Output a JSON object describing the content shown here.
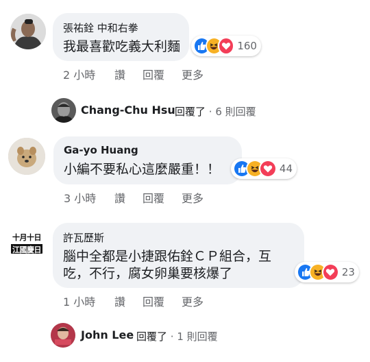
{
  "comments": [
    {
      "author": "張祐銓 中和右拳",
      "text": "我最喜歡吃義大利麵",
      "reactions": {
        "count": "160",
        "icons": [
          "like-icon",
          "haha-icon",
          "love-icon"
        ]
      },
      "actions": {
        "time": "2 小時",
        "like": "讚",
        "reply": "回覆",
        "more": "更多"
      }
    },
    {
      "author": "Ga-yo Huang",
      "text": "小編不要私心這麼嚴重！！",
      "reactions": {
        "count": "44",
        "icons": [
          "like-icon",
          "haha-icon",
          "love-icon"
        ]
      },
      "actions": {
        "time": "3 小時",
        "like": "讚",
        "reply": "回覆",
        "more": "更多"
      }
    },
    {
      "author": "許瓦歷斯",
      "text_line1": "腦中全都是小捷跟佑銓ＣＰ組合，互",
      "text_line2": "吃，不行，腐女卵巢要核爆了",
      "reactions": {
        "count": "23",
        "icons": [
          "like-icon",
          "haha-icon",
          "love-icon"
        ]
      },
      "actions": {
        "time": "1 小時",
        "like": "讚",
        "reply": "回覆",
        "more": "更多"
      },
      "avatar_text_line1": "十月十日",
      "avatar_text_line2": "江國慶日"
    }
  ],
  "replies": [
    {
      "author": "Chang-Chu Hsu",
      "verb": "回覆了",
      "sep": " · ",
      "count": "6 則回覆"
    },
    {
      "author": "John Lee",
      "verb": "回覆了",
      "sep": " · ",
      "count": "1 則回覆"
    }
  ],
  "colors": {
    "bubble": "#f0f2f5",
    "like": "#1877f2",
    "love": "#f33e58",
    "haha": "#f7b125",
    "muted": "#65676b"
  }
}
